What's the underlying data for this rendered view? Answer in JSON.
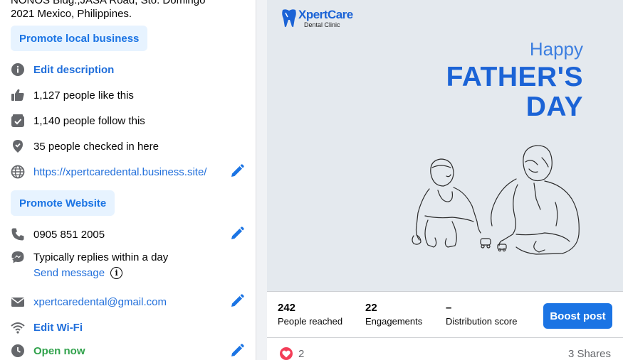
{
  "about": {
    "address_line1": "NONOS Bldg.,JASA Road, Sto. Domingo",
    "address_line2": "2021 Mexico, Philippines.",
    "promote_local": "Promote local business",
    "edit_description": "Edit description",
    "likes": "1,127 people like this",
    "follows": "1,140 people follow this",
    "checkins": "35 people checked in here",
    "website": "https://xpertcaredental.business.site/",
    "promote_website": "Promote Website",
    "phone": "0905 851 2005",
    "replies": "Typically replies within a day",
    "send_message": "Send message",
    "email": "xpertcaredental@gmail.com",
    "edit_wifi": "Edit Wi-Fi",
    "open_now": "Open now"
  },
  "post": {
    "logo_brand": "XpertCare",
    "logo_sub": "Dental Clinic",
    "happy": "Happy",
    "fathers": "FATHER'S",
    "day": "DAY",
    "reached_value": "242",
    "reached_label": "People reached",
    "engagements_value": "22",
    "engagements_label": "Engagements",
    "distribution_value": "–",
    "distribution_label": "Distribution score",
    "boost": "Boost post",
    "reaction_count": "2",
    "shares": "3 Shares"
  },
  "colors": {
    "accent": "#1b74e4",
    "link": "#216fdb",
    "open": "#31a24c",
    "heart": "#f33e58"
  }
}
